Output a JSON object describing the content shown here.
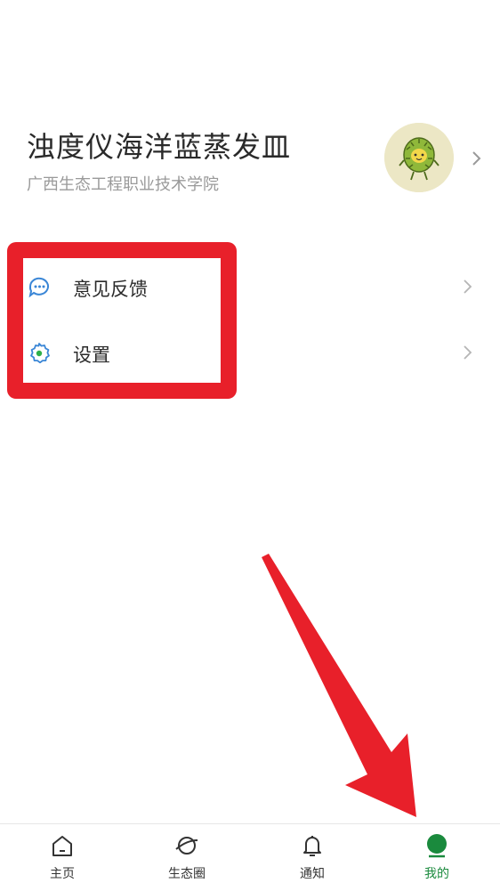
{
  "profile": {
    "username": "浊度仪海洋蓝蒸发皿",
    "school": "广西生态工程职业技术学院",
    "avatar_icon": "durian-avatar-icon"
  },
  "menu": {
    "items": [
      {
        "label": "意见反馈",
        "icon": "feedback-chat-icon"
      },
      {
        "label": "设置",
        "icon": "settings-gear-icon"
      }
    ]
  },
  "tabbar": {
    "items": [
      {
        "label": "主页",
        "icon": "home-icon",
        "active": false
      },
      {
        "label": "生态圈",
        "icon": "planet-icon",
        "active": false
      },
      {
        "label": "通知",
        "icon": "bell-icon",
        "active": false
      },
      {
        "label": "我的",
        "icon": "profile-icon",
        "active": true
      }
    ]
  },
  "colors": {
    "accent_green": "#1a8a3d",
    "annotation_red": "#e8202a",
    "text_primary": "#2a2a2a",
    "text_secondary": "#9a9a9a"
  }
}
